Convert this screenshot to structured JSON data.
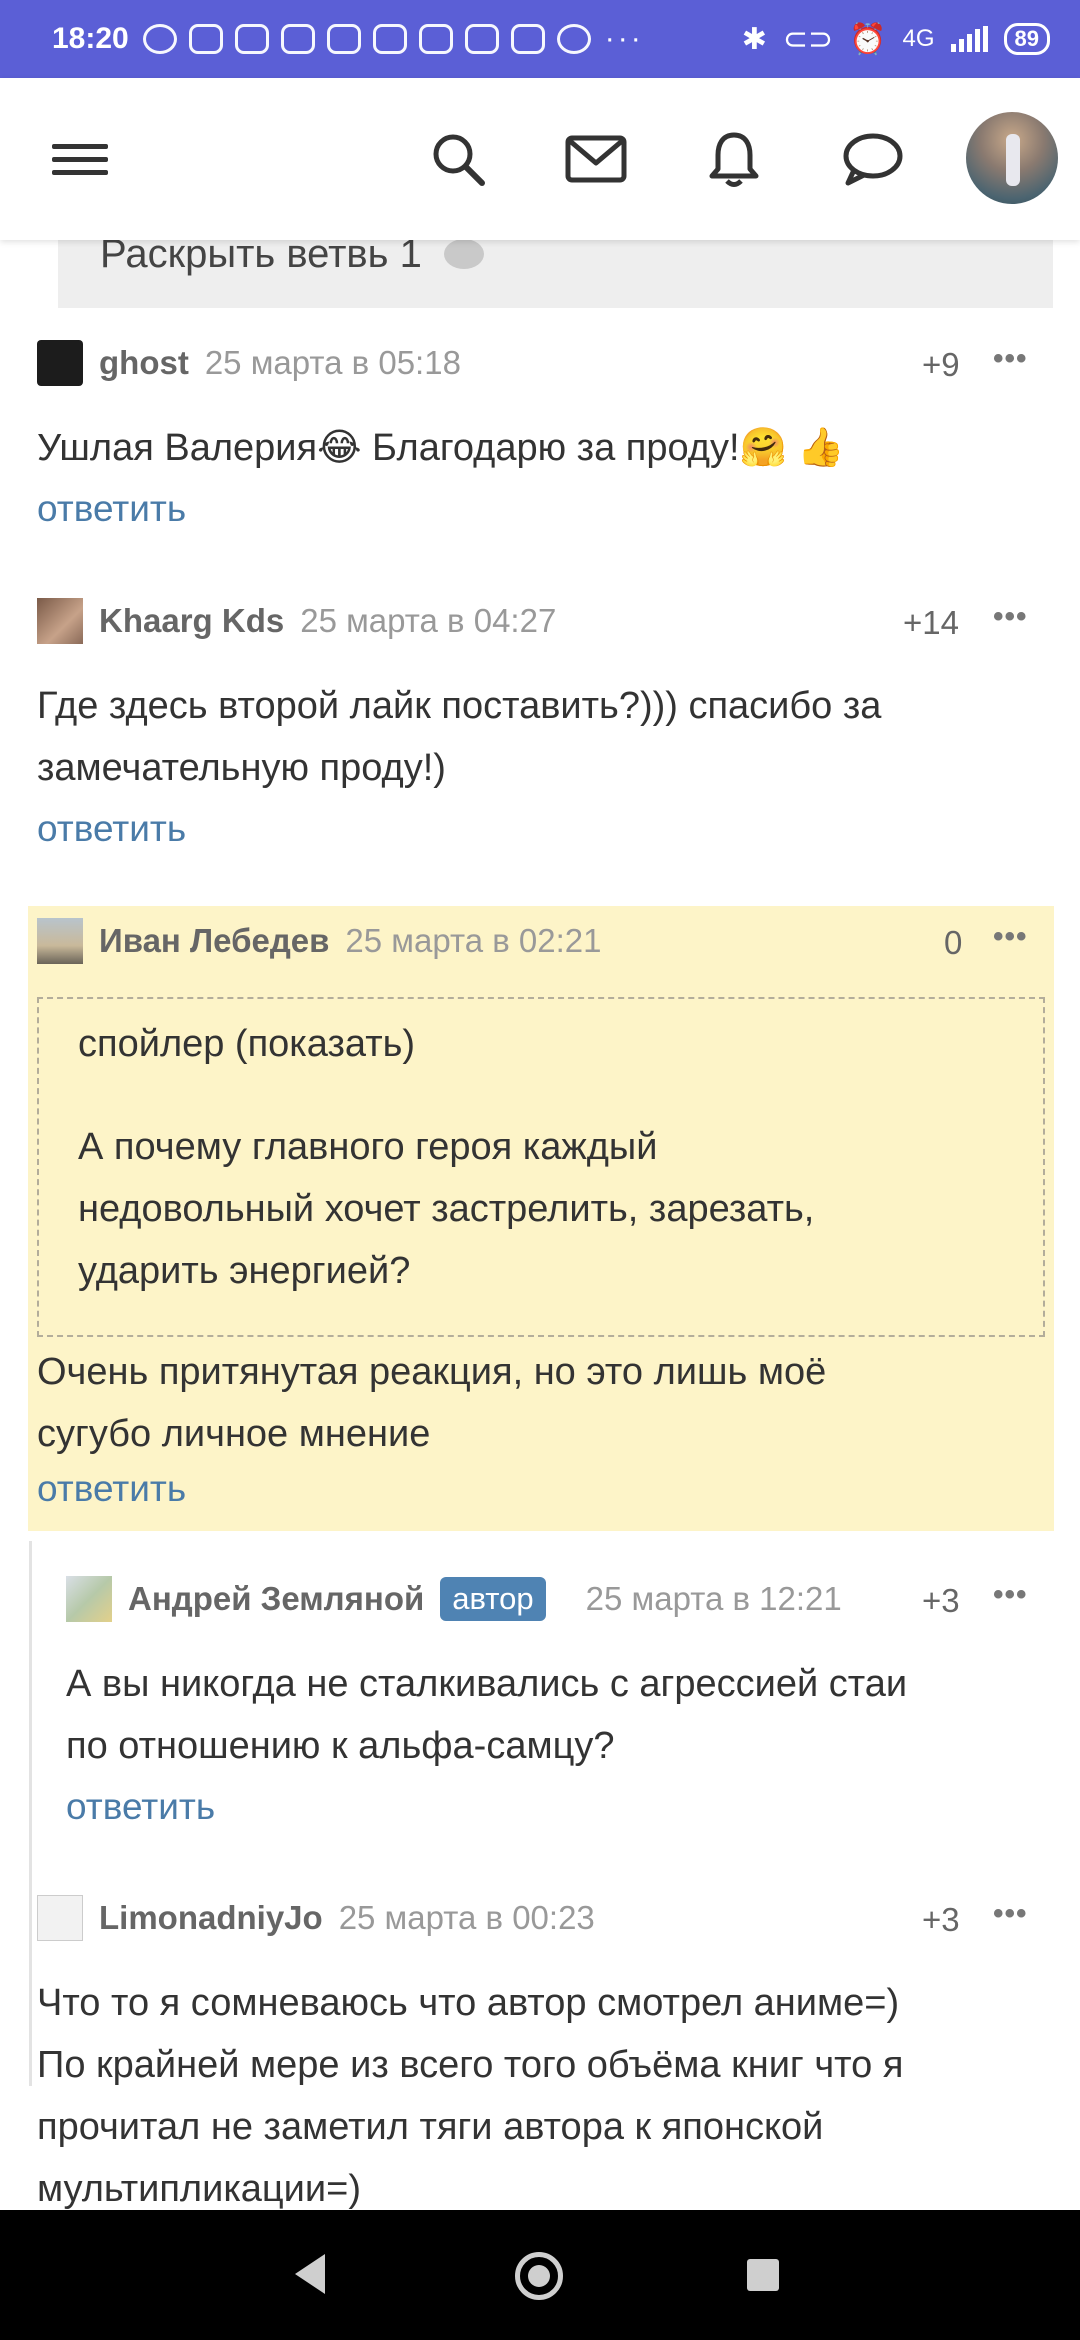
{
  "status_bar": {
    "time": "18:20",
    "network": "4G",
    "battery": "89"
  },
  "app_bar": {
    "icons": [
      "menu-icon",
      "search-icon",
      "mail-icon",
      "bell-icon",
      "chat-icon"
    ]
  },
  "thread": {
    "expand_label": "Раскрыть ветвь 1"
  },
  "comments": [
    {
      "author": "ghost",
      "date": "25 марта в 05:18",
      "score": "+9",
      "text": "Ушлая Валерия😂  Благодарю за проду!🤗 👍",
      "reply": "ответить"
    },
    {
      "author": "Khaarg Kds",
      "date": "25 марта в 04:27",
      "score": "+14",
      "text_lines": [
        "Где здесь второй лайк поставить?))) спасибо за",
        "замечательную проду!)"
      ],
      "reply": "ответить"
    },
    {
      "author": "Иван Лебедев",
      "date": "25 марта в 02:21",
      "score": "0",
      "spoiler_title": "спойлер (показать)",
      "spoiler_lines": [
        "А почему главного героя каждый",
        "недовольный хочет застрелить, зарезать,",
        "ударить энергией?"
      ],
      "text_lines": [
        "Очень притянутая реакция, но это лишь моё",
        "сугубо личное мнение"
      ],
      "reply": "ответить"
    },
    {
      "author": "Андрей Земляной",
      "badge": "автор",
      "date": "25 марта в 12:21",
      "score": "+3",
      "text_lines": [
        "А вы никогда не сталкивались с агрессией стаи",
        "по отношению к альфа-самцу?"
      ],
      "reply": "ответить"
    },
    {
      "author": "LimonadniyJo",
      "date": "25 марта в 00:23",
      "score": "+3",
      "text_lines": [
        "Что то я сомневаюсь что автор смотрел аниме=)",
        "По крайней мере из всего того объёма книг что я",
        "прочитал не заметил тяги автора к японской",
        "мультипликации=)"
      ]
    }
  ],
  "colors": {
    "status_bar": "#5b5fd6",
    "highlight": "#fdf4c8",
    "link": "#4a7ba8",
    "author_badge": "#4f83b3"
  }
}
